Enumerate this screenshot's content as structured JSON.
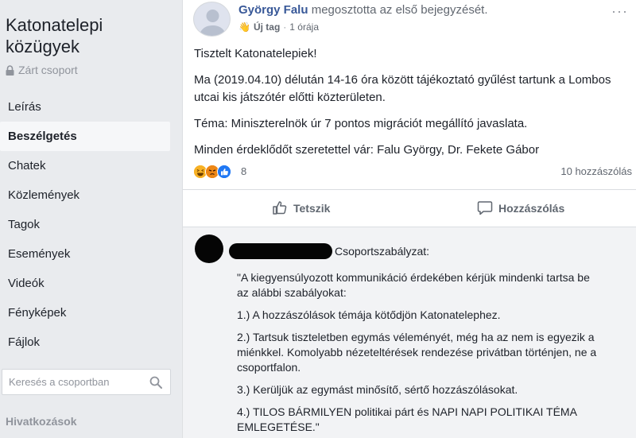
{
  "sidebar": {
    "group_title": "Katonatelepi közügyek",
    "privacy_label": "Zárt csoport",
    "items": [
      {
        "label": "Leírás",
        "active": false
      },
      {
        "label": "Beszélgetés",
        "active": true
      },
      {
        "label": "Chatek",
        "active": false
      },
      {
        "label": "Közlemények",
        "active": false
      },
      {
        "label": "Tagok",
        "active": false
      },
      {
        "label": "Események",
        "active": false
      },
      {
        "label": "Videók",
        "active": false
      },
      {
        "label": "Fényképek",
        "active": false
      },
      {
        "label": "Fájlok",
        "active": false
      }
    ],
    "search_placeholder": "Keresés a csoportban",
    "links_heading": "Hivatkozások"
  },
  "post": {
    "author": "György Falu",
    "action_text": "megosztotta az első bejegyzését.",
    "tag_label": "Új tag",
    "separator": "·",
    "time": "1 órája",
    "wave_emoji": "👋",
    "body": [
      "Tisztelt Katonatelepiek!",
      "Ma (2019.04.10) délután 14-16 óra között tájékoztató gyűlést tartunk a Lombos utcai kis játszótér előtti közterületen.",
      "Téma: Miniszterelnök úr 7 pontos migrációt megállító javaslata.",
      "Minden érdeklődőt szeretettel vár: Falu György, Dr. Fekete Gábor"
    ],
    "reaction_count": "8",
    "comment_count": "10 hozzászólás",
    "like_label": "Tetszik",
    "comment_label": "Hozzászólás"
  },
  "comment": {
    "heading": "Csoportszabályzat:",
    "paragraphs": [
      "\"A kiegyensúlyozott kommunikáció érdekében kérjük mindenki tartsa be az alábbi szabályokat:",
      "1.) A hozzászólások témája kötődjön Katonatelephez.",
      "2.) Tartsuk tiszteletben egymás véleményét, még ha az nem is egyezik a miénkkel. Komolyabb nézeteltérések rendezése privátban történjen, ne a csoportfalon.",
      "3.) Kerüljük az egymást minősítő, sértő hozzászólásokat.",
      "4.) TILOS BÁRMILYEN politikai párt és NAPI NAPI POLITIKAI TÉMA EMLEGETÉSE.\""
    ]
  },
  "colors": {
    "link_blue": "#385898",
    "background": "#e9ebee",
    "like_blue": "#2078f4",
    "haha_yellow": "#f7b125",
    "angry_orange": "#e9710f"
  },
  "icons": {
    "privacy": "lock-icon",
    "search": "search-icon",
    "like": "thumbs-up-icon",
    "comment": "speech-bubble-icon",
    "more": "more-options-icon"
  }
}
